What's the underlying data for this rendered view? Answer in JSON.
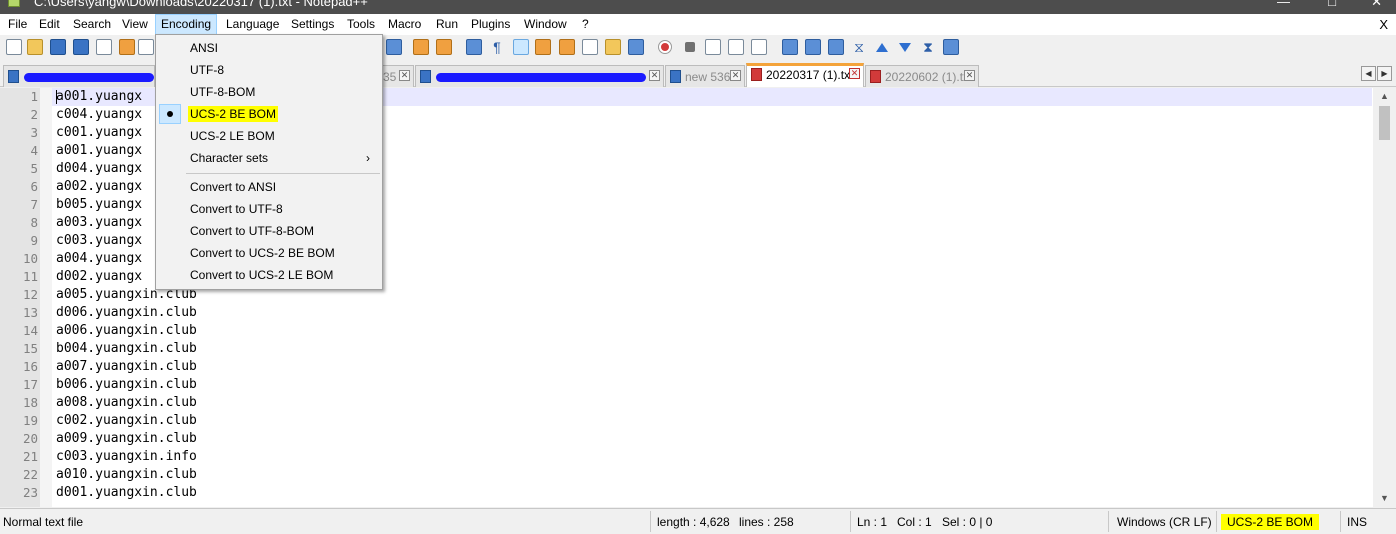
{
  "window": {
    "title": "C:\\Users\\yangw\\Downloads\\20220317 (1).txt - Notepad++",
    "minimize": "—",
    "maximize": "□",
    "close": "✕"
  },
  "menubar": {
    "items": [
      "File",
      "Edit",
      "Search",
      "View",
      "Encoding",
      "Language",
      "Settings",
      "Tools",
      "Macro",
      "Run",
      "Plugins",
      "Window",
      "?"
    ],
    "active": "Encoding",
    "close_doc": "X"
  },
  "tabs": [
    {
      "label": "",
      "redacted": true,
      "close": "✕"
    },
    {
      "label": "35",
      "redacted": false,
      "close": "✕"
    },
    {
      "label": "",
      "redacted": true,
      "close": "✕"
    },
    {
      "label": "new 536",
      "redacted": false,
      "close": "✕"
    },
    {
      "label": "20220317 (1).txt",
      "redacted": false,
      "active": true,
      "close": "✕"
    },
    {
      "label": "20220602 (1).txt",
      "redacted": false,
      "close": "✕"
    }
  ],
  "tab_nav": {
    "left": "◀",
    "right": "▶"
  },
  "encoding_menu": {
    "items": [
      "ANSI",
      "UTF-8",
      "UTF-8-BOM",
      "UCS-2 BE BOM",
      "UCS-2 LE BOM",
      "Character sets"
    ],
    "convert_items": [
      "Convert to ANSI",
      "Convert to UTF-8",
      "Convert to UTF-8-BOM",
      "Convert to UCS-2 BE BOM",
      "Convert to UCS-2 LE BOM"
    ],
    "selected": "UCS-2 BE BOM",
    "submenu_arrow": "›"
  },
  "editor": {
    "lines": [
      {
        "n": "1",
        "text": "a001.yuangx"
      },
      {
        "n": "2",
        "text": "c004.yuangx"
      },
      {
        "n": "3",
        "text": "c001.yuangx"
      },
      {
        "n": "4",
        "text": "a001.yuangx"
      },
      {
        "n": "5",
        "text": "d004.yuangx"
      },
      {
        "n": "6",
        "text": "a002.yuangx"
      },
      {
        "n": "7",
        "text": "b005.yuangx"
      },
      {
        "n": "8",
        "text": "a003.yuangx"
      },
      {
        "n": "9",
        "text": "c003.yuangx"
      },
      {
        "n": "10",
        "text": "a004.yuangx"
      },
      {
        "n": "11",
        "text": "d002.yuangx"
      },
      {
        "n": "12",
        "text": "a005.yuangxin.club"
      },
      {
        "n": "13",
        "text": "d006.yuangxin.club"
      },
      {
        "n": "14",
        "text": "a006.yuangxin.club"
      },
      {
        "n": "15",
        "text": "b004.yuangxin.club"
      },
      {
        "n": "16",
        "text": "a007.yuangxin.club"
      },
      {
        "n": "17",
        "text": "b006.yuangxin.club"
      },
      {
        "n": "18",
        "text": "a008.yuangxin.club"
      },
      {
        "n": "19",
        "text": "c002.yuangxin.club"
      },
      {
        "n": "20",
        "text": "a009.yuangxin.club"
      },
      {
        "n": "21",
        "text": "c003.yuangxin.info"
      },
      {
        "n": "22",
        "text": "a010.yuangxin.club"
      },
      {
        "n": "23",
        "text": "d001.yuangxin.club"
      }
    ],
    "scroll_up": "▲",
    "scroll_down": "▼"
  },
  "statusbar": {
    "file_type": "Normal text file",
    "length": "length : 4,628",
    "lines": "lines : 258",
    "ln": "Ln : 1",
    "col": "Col : 1",
    "sel": "Sel : 0 | 0",
    "eol": "Windows (CR LF)",
    "encoding": "UCS-2 BE BOM",
    "mode": "INS"
  },
  "colors": {
    "highlight": "#ffff00",
    "menu_active": "#cce8ff",
    "active_tab_accent": "#f4a33a",
    "redaction": "#1a1aff"
  }
}
